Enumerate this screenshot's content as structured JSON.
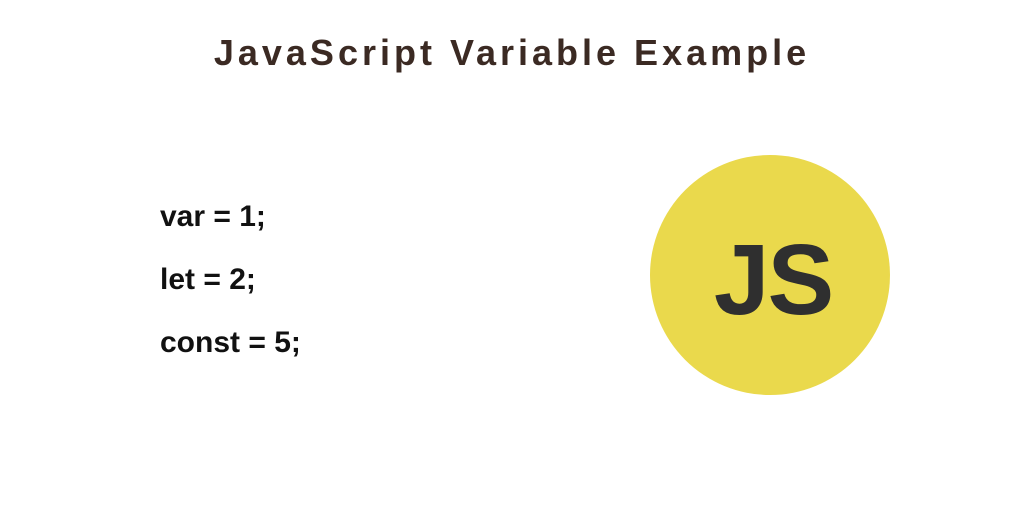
{
  "title": "JavaScript Variable Example",
  "code": {
    "lines": [
      "var = 1;",
      "let = 2;",
      "const = 5;"
    ]
  },
  "logo": {
    "text": "JS",
    "bg_color": "#ead94c",
    "fg_color": "#2f2f2f"
  }
}
